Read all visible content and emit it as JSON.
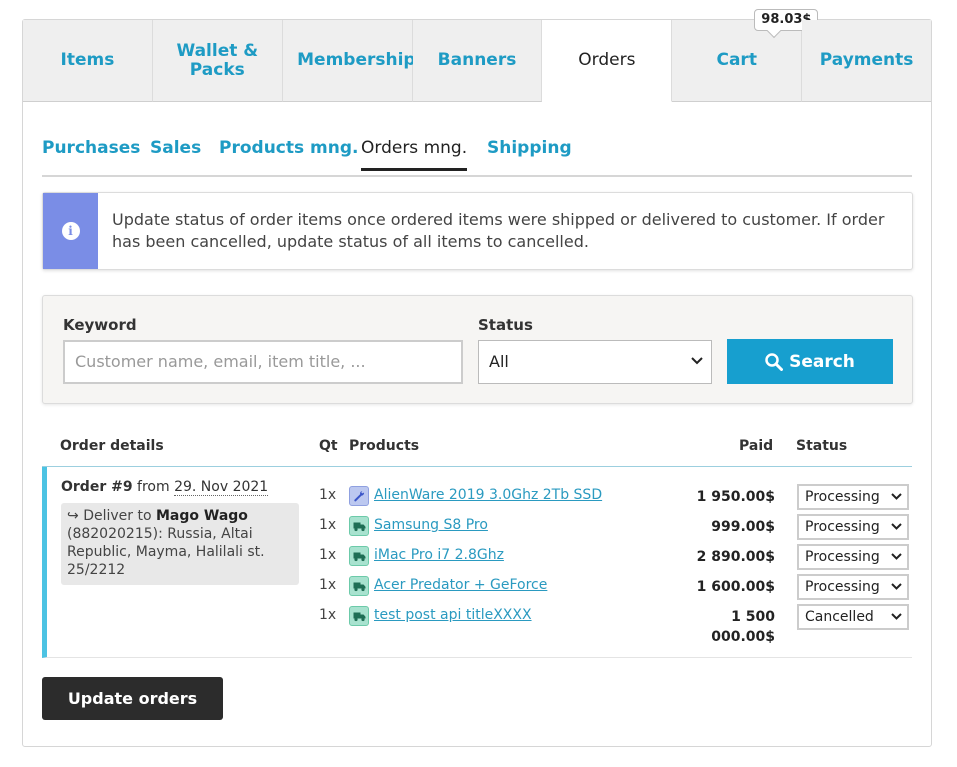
{
  "top_tabs": [
    {
      "label": "Items",
      "active": false
    },
    {
      "label": "Wallet & Packs",
      "active": false
    },
    {
      "label": "Membership",
      "active": false
    },
    {
      "label": "Banners",
      "active": false
    },
    {
      "label": "Orders",
      "active": true
    },
    {
      "label": "Cart",
      "active": false,
      "badge": "98.03$"
    },
    {
      "label": "Payments",
      "active": false
    }
  ],
  "sub_tabs": [
    {
      "label": "Purchases",
      "active": false
    },
    {
      "label": "Sales",
      "active": false
    },
    {
      "label": "Products mng.",
      "active": false
    },
    {
      "label": "Orders mng.",
      "active": true
    },
    {
      "label": "Shipping",
      "active": false
    }
  ],
  "info": {
    "icon": "info-icon",
    "text": "Update status of order items once ordered items were shipped or delivered to customer. If order has been cancelled, update status of all items to cancelled."
  },
  "search": {
    "keyword_label": "Keyword",
    "keyword_placeholder": "Customer name, email, item title, ...",
    "status_label": "Status",
    "status_value": "All",
    "button_label": "Search"
  },
  "table": {
    "headers": {
      "order_details": "Order details",
      "qt": "Qt",
      "products": "Products",
      "paid": "Paid",
      "status": "Status"
    },
    "order": {
      "number": "Order #9",
      "from": "from",
      "date": "29. Nov 2021",
      "deliver_prefix": "Deliver to",
      "deliver_name": "Mago Wago",
      "deliver_address": "(882020215): Russia, Altai Republic, Mayma, Halilali st. 25/2212",
      "items": [
        {
          "qt": "1x",
          "icon": "wrench-icon",
          "product": "AlienWare 2019 3.0Ghz 2Tb SSD",
          "paid": "1 950.00$",
          "status": "Processing"
        },
        {
          "qt": "1x",
          "icon": "truck-icon",
          "product": "Samsung S8 Pro",
          "paid": "999.00$",
          "status": "Processing"
        },
        {
          "qt": "1x",
          "icon": "truck-icon",
          "product": "iMac Pro i7 2.8Ghz",
          "paid": "2 890.00$",
          "status": "Processing"
        },
        {
          "qt": "1x",
          "icon": "truck-icon",
          "product": "Acer Predator + GeForce",
          "paid": "1 600.00$",
          "status": "Processing"
        },
        {
          "qt": "1x",
          "icon": "truck-icon",
          "product": "test post api titleXXXX",
          "paid_line1": "1 500",
          "paid_line2": "000.00$",
          "status": "Cancelled"
        }
      ]
    }
  },
  "update_button": "Update orders",
  "colors": {
    "accent": "#1e9bc4",
    "search_button": "#179fcf",
    "info_side": "#7a8de6",
    "order_border": "#4cc3e3",
    "dark_button": "#2c2c2c"
  }
}
